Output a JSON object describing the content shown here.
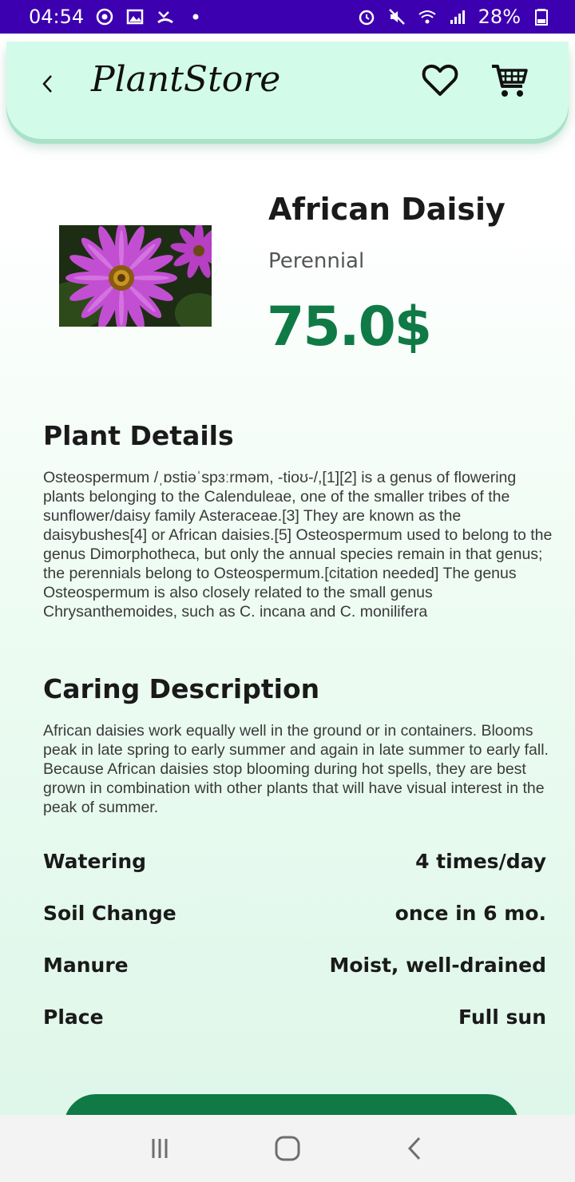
{
  "status_bar": {
    "time": "04:54",
    "battery": "28%"
  },
  "header": {
    "title": "PlantStore"
  },
  "product": {
    "name": "African Daisiy",
    "category": "Perennial",
    "price": "75.0$"
  },
  "details": {
    "title": "Plant Details",
    "text": "Osteospermum /ˌɒstiəˈspɜːrməm, -tioʊ-/,[1][2] is a genus of flowering plants belonging to the Calenduleae, one of the smaller tribes of the sunflower/daisy family Asteraceae.[3] They are known as the daisybushes[4] or African daisies.[5] Osteospermum used to belong to the genus Dimorphotheca, but only the annual species remain in that genus; the perennials belong to Osteospermum.[citation needed] The genus Osteospermum is also closely related to the small genus Chrysanthemoides, such as C. incana and C. monilifera"
  },
  "caring": {
    "title": "Caring Description",
    "text": "African daisies work equally well in the ground or in containers. Blooms peak in late spring to early summer and again in late summer to early fall. Because African daisies stop blooming during hot spells, they are best grown in combination with other plants that will have visual interest in the peak of summer.",
    "rows": [
      {
        "label": "Watering",
        "value": "4 times/day"
      },
      {
        "label": "Soil Change",
        "value": "once in 6 mo."
      },
      {
        "label": "Manure",
        "value": "Moist, well-drained"
      },
      {
        "label": "Place",
        "value": "Full sun"
      }
    ]
  },
  "colors": {
    "status_bar": "#3d00b0",
    "header_bg": "#d3fbe9",
    "accent_green": "#0f7a45"
  },
  "icons": {
    "back": "chevron-left-icon",
    "favorite": "heart-outline-icon",
    "cart": "shopping-cart-icon"
  }
}
